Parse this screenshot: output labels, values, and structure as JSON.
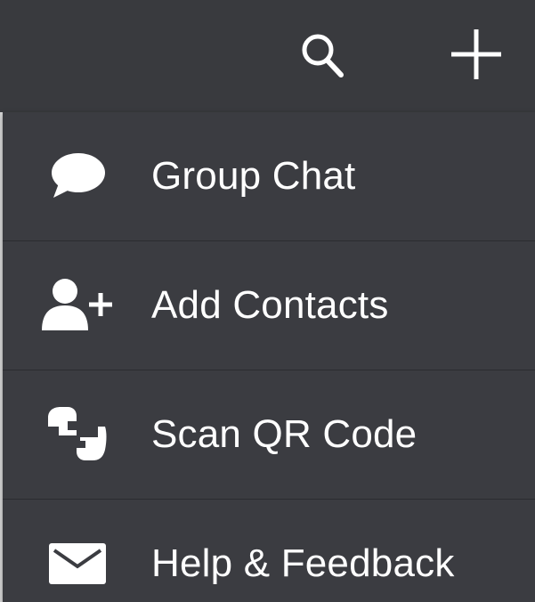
{
  "toolbar": {
    "search_icon": "search-icon",
    "add_icon": "plus-icon"
  },
  "menu": {
    "items": [
      {
        "label": "Group Chat",
        "icon": "chat-bubble-icon"
      },
      {
        "label": "Add Contacts",
        "icon": "add-person-icon"
      },
      {
        "label": "Scan QR Code",
        "icon": "scan-qr-icon"
      },
      {
        "label": "Help & Feedback",
        "icon": "envelope-icon"
      }
    ]
  },
  "colors": {
    "background": "#3a3b3f",
    "menu_background": "#3b3c41",
    "divider": "#2b2c30",
    "foreground": "#ffffff"
  }
}
